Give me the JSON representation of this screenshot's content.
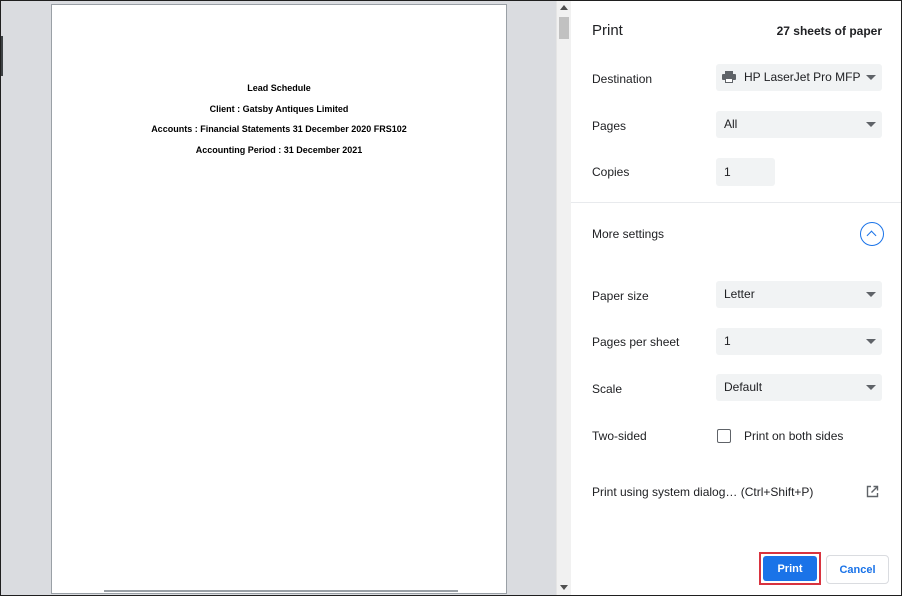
{
  "preview": {
    "document_lines": [
      "Lead Schedule",
      "Client : Gatsby Antiques Limited",
      "Accounts : Financial Statements 31 December 2020 FRS102",
      "Accounting Period : 31 December 2021"
    ]
  },
  "header": {
    "title": "Print",
    "sheet_count": "27 sheets of paper"
  },
  "destination": {
    "label": "Destination",
    "value": "HP LaserJet Pro MFP",
    "icon": "printer-icon"
  },
  "pages": {
    "label": "Pages",
    "value": "All"
  },
  "copies": {
    "label": "Copies",
    "value": "1"
  },
  "more_settings": {
    "label": "More settings",
    "icon": "chevron-up-icon"
  },
  "paper_size": {
    "label": "Paper size",
    "value": "Letter"
  },
  "pages_per_sheet": {
    "label": "Pages per sheet",
    "value": "1"
  },
  "scale": {
    "label": "Scale",
    "value": "Default"
  },
  "two_sided": {
    "label": "Two-sided",
    "option": "Print on both sides",
    "checked": false
  },
  "system_dialog": {
    "label": "Print using system dialog… (Ctrl+Shift+P)",
    "icon": "open-external-icon"
  },
  "actions": {
    "print": "Print",
    "cancel": "Cancel"
  },
  "colors": {
    "accent": "#1a73e8",
    "highlight": "#d9333f",
    "preview_bg": "#dadce0"
  }
}
